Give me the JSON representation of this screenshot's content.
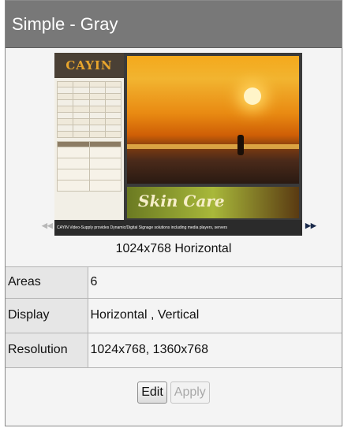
{
  "template": {
    "title": "Simple - Gray",
    "thumbnail": {
      "logo": "CAYIN",
      "ticker": "CAYIN Video-Supply provides Dynamic/Digital Signage solutions including media players, servers",
      "banner": "Skin Care",
      "nav_prev": "◀◀",
      "nav_next": "▶▶"
    },
    "caption": "1024x768 Horizontal",
    "rows": [
      {
        "label": "Areas",
        "value": "6"
      },
      {
        "label": "Display",
        "value": "Horizontal , Vertical"
      },
      {
        "label": "Resolution",
        "value": "1024x768, 1360x768"
      }
    ],
    "buttons": {
      "edit": "Edit",
      "apply": "Apply"
    }
  }
}
